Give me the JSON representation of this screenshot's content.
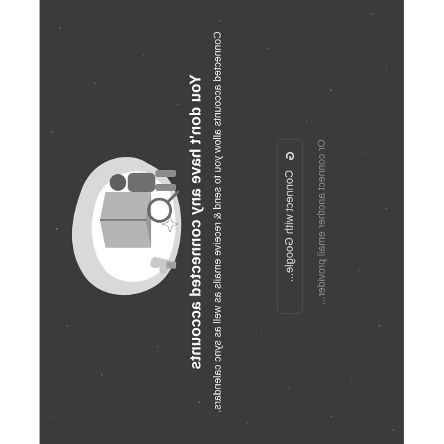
{
  "empty_state": {
    "title": "You don't have any connected accounts",
    "subtitle": "Connected accounts allow you to send & receive emails as well as sync calendars.",
    "google_button_label": "Connect with Google...",
    "other_provider_label": "Or connect another email provider..."
  },
  "colors": {
    "panel_background": "#3b3b3b",
    "outer_background": "#ffffff",
    "title_text": "#ffffff",
    "muted_text": "#8c8c8c"
  },
  "icons": {
    "google_button_icon": "google-g-icon",
    "illustration": "person-with-book-illustration"
  }
}
